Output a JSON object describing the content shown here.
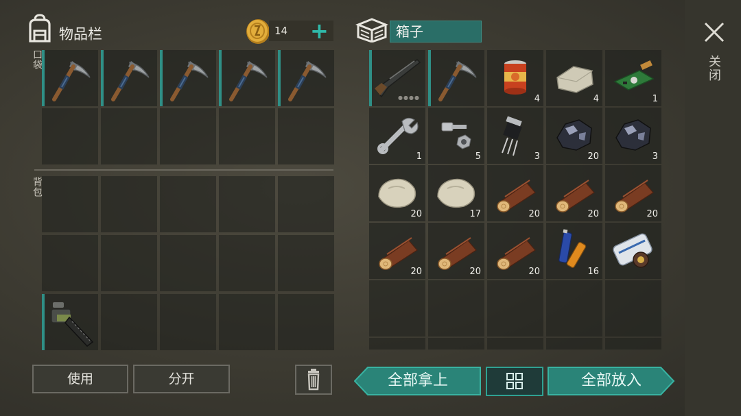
{
  "inventory": {
    "title": "物品栏",
    "pocket_label": "口袋",
    "backpack_label": "背包",
    "coins": "14",
    "plus": "+"
  },
  "container": {
    "name": "箱子"
  },
  "close": {
    "label": "关闭"
  },
  "pocket_slots": [
    {
      "item": "pickaxe-icon",
      "qty": ""
    },
    {
      "item": "pickaxe-icon",
      "qty": ""
    },
    {
      "item": "pickaxe-icon",
      "qty": ""
    },
    {
      "item": "pickaxe-icon",
      "qty": ""
    },
    {
      "item": "pickaxe-icon",
      "qty": ""
    }
  ],
  "backpack_slots": [
    {
      "item": "chainsaw-icon",
      "qty": ""
    }
  ],
  "box_slots": [
    {
      "item": "shotgun-icon",
      "qty": ""
    },
    {
      "item": "pickaxe-icon",
      "qty": ""
    },
    {
      "item": "canned-food-icon",
      "qty": "4"
    },
    {
      "item": "stone-block-icon",
      "qty": "4"
    },
    {
      "item": "circuit-board-icon",
      "qty": "1"
    },
    {
      "item": "wrench-icon",
      "qty": "1"
    },
    {
      "item": "bolt-nut-icon",
      "qty": "5"
    },
    {
      "item": "transistor-icon",
      "qty": "3"
    },
    {
      "item": "iron-ore-icon",
      "qty": "20"
    },
    {
      "item": "iron-ore-icon",
      "qty": "3"
    },
    {
      "item": "stone-icon",
      "qty": "20"
    },
    {
      "item": "stone-icon",
      "qty": "17"
    },
    {
      "item": "wood-log-icon",
      "qty": "20"
    },
    {
      "item": "wood-log-icon",
      "qty": "20"
    },
    {
      "item": "wood-log-icon",
      "qty": "20"
    },
    {
      "item": "wood-log-icon",
      "qty": "20"
    },
    {
      "item": "wood-log-icon",
      "qty": "20"
    },
    {
      "item": "wood-log-icon",
      "qty": "20"
    },
    {
      "item": "batteries-icon",
      "qty": "16"
    },
    {
      "item": "map-scroll-icon",
      "qty": ""
    }
  ],
  "buttons": {
    "use": "使用",
    "split": "分开",
    "take_all": "全部拿上",
    "put_all": "全部放入"
  },
  "colors": {
    "accent": "#2fa192",
    "slot_bar": "#2f8f86",
    "name_field": "#2a6e67"
  }
}
